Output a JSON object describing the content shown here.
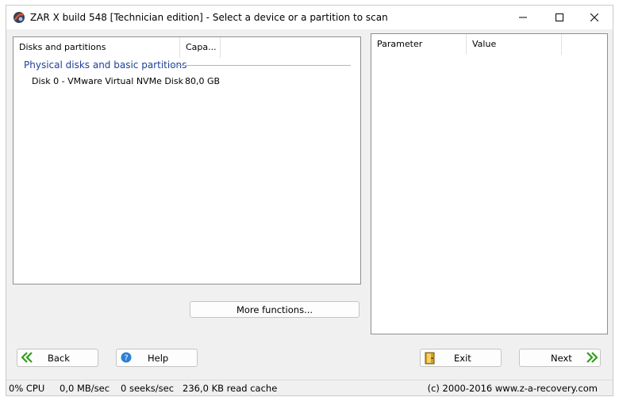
{
  "window": {
    "title": "ZAR X build 548 [Technician edition] - Select a device or a partition to scan"
  },
  "left_panel": {
    "columns": [
      "Disks and partitions",
      "Capa..."
    ],
    "group_label": "Physical disks and basic partitions",
    "rows": [
      {
        "name": "Disk 0 - VMware Virtual NVMe Disk",
        "capacity": "80,0 GB"
      }
    ],
    "more_button": "More functions..."
  },
  "right_panel": {
    "columns": [
      "Parameter",
      "Value"
    ]
  },
  "buttons": {
    "back": "Back",
    "help": "Help",
    "exit": "Exit",
    "next": "Next"
  },
  "status": {
    "cpu": "0% CPU",
    "throughput": "0,0 MB/sec",
    "seeks": "0 seeks/sec",
    "cache": "236,0 KB read cache",
    "copyright": "(c) 2000-2016 www.z-a-recovery.com"
  },
  "colors": {
    "group_text": "#1e3f96",
    "arrow_green": "#2f9e1a",
    "help_blue": "#2f7fd1"
  }
}
